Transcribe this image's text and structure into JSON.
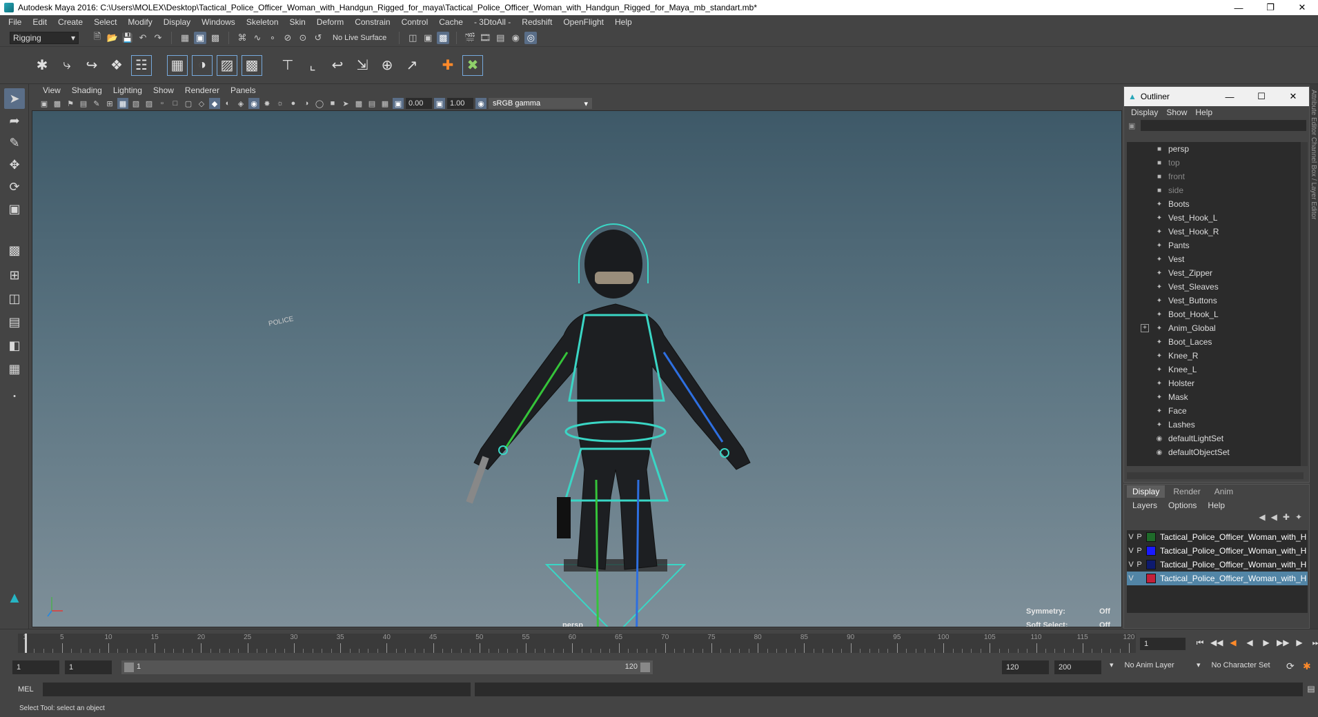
{
  "window": {
    "title": "Autodesk Maya 2016: C:\\Users\\MOLEX\\Desktop\\Tactical_Police_Officer_Woman_with_Handgun_Rigged_for_maya\\Tactical_Police_Officer_Woman_with_Handgun_Rigged_for_Maya_mb_standart.mb*"
  },
  "menubar": [
    "File",
    "Edit",
    "Create",
    "Select",
    "Modify",
    "Display",
    "Windows",
    "Skeleton",
    "Skin",
    "Deform",
    "Constrain",
    "Control",
    "Cache",
    "- 3DtoAll -",
    "Redshift",
    "OpenFlight",
    "Help"
  ],
  "statusline": {
    "mode": "Rigging",
    "live_surface": "No Live Surface"
  },
  "viewport": {
    "menu": [
      "View",
      "Shading",
      "Lighting",
      "Show",
      "Renderer",
      "Panels"
    ],
    "near_value": "0.00",
    "far_value": "1.00",
    "color_space": "sRGB gamma",
    "camera_label": "persp",
    "hud": {
      "symmetry_label": "Symmetry:",
      "symmetry_value": "Off",
      "soft_select_label": "Soft Select:",
      "soft_select_value": "Off"
    },
    "character_text": "POLICE"
  },
  "outliner": {
    "title": "Outliner",
    "menu": [
      "Display",
      "Show",
      "Help"
    ],
    "items": [
      {
        "label": "persp",
        "kind": "camera",
        "dim": false
      },
      {
        "label": "top",
        "kind": "camera",
        "dim": true
      },
      {
        "label": "front",
        "kind": "camera",
        "dim": true
      },
      {
        "label": "side",
        "kind": "camera",
        "dim": true
      },
      {
        "label": "Boots",
        "kind": "mesh",
        "dim": false
      },
      {
        "label": "Vest_Hook_L",
        "kind": "mesh",
        "dim": false
      },
      {
        "label": "Vest_Hook_R",
        "kind": "mesh",
        "dim": false
      },
      {
        "label": "Pants",
        "kind": "mesh",
        "dim": false
      },
      {
        "label": "Vest",
        "kind": "mesh",
        "dim": false
      },
      {
        "label": "Vest_Zipper",
        "kind": "mesh",
        "dim": false
      },
      {
        "label": "Vest_Sleaves",
        "kind": "mesh",
        "dim": false
      },
      {
        "label": "Vest_Buttons",
        "kind": "mesh",
        "dim": false
      },
      {
        "label": "Boot_Hook_L",
        "kind": "mesh",
        "dim": false
      },
      {
        "label": "Anim_Global",
        "kind": "mesh",
        "dim": false,
        "expandable": true
      },
      {
        "label": "Boot_Laces",
        "kind": "mesh",
        "dim": false
      },
      {
        "label": "Knee_R",
        "kind": "mesh",
        "dim": false
      },
      {
        "label": "Knee_L",
        "kind": "mesh",
        "dim": false
      },
      {
        "label": "Holster",
        "kind": "mesh",
        "dim": false
      },
      {
        "label": "Mask",
        "kind": "mesh",
        "dim": false
      },
      {
        "label": "Face",
        "kind": "mesh",
        "dim": false
      },
      {
        "label": "Lashes",
        "kind": "mesh",
        "dim": false
      },
      {
        "label": "defaultLightSet",
        "kind": "set",
        "dim": false
      },
      {
        "label": "defaultObjectSet",
        "kind": "set",
        "dim": false
      }
    ]
  },
  "layers": {
    "tabs": [
      "Display",
      "Render",
      "Anim"
    ],
    "menu": [
      "Layers",
      "Options",
      "Help"
    ],
    "rows": [
      {
        "v": "V",
        "p": "P",
        "color": "#1f6b2a",
        "name": "Tactical_Police_Officer_Woman_with_H",
        "selected": false
      },
      {
        "v": "V",
        "p": "P",
        "color": "#1a1aff",
        "name": "Tactical_Police_Officer_Woman_with_H",
        "selected": false
      },
      {
        "v": "V",
        "p": "P",
        "color": "#0d1a6e",
        "name": "Tactical_Police_Officer_Woman_with_H",
        "selected": false
      },
      {
        "v": "V",
        "p": "",
        "color": "#c2203a",
        "name": "Tactical_Police_Officer_Woman_with_H",
        "selected": true
      }
    ]
  },
  "right_strip": "Attribute Editor  Channel Box / Layer Editor",
  "timeline": {
    "labels": [
      "1",
      "5",
      "10",
      "15",
      "20",
      "25",
      "30",
      "35",
      "40",
      "45",
      "50",
      "55",
      "60",
      "65",
      "70",
      "75",
      "80",
      "85",
      "90",
      "95",
      "100",
      "105",
      "110",
      "115",
      "120"
    ],
    "current_frame": "1"
  },
  "range": {
    "start": "1",
    "playback_start": "1",
    "slider_start": "1",
    "slider_end": "120",
    "playback_end": "120",
    "end": "200",
    "anim_layer": "No Anim Layer",
    "character_set": "No Character Set"
  },
  "cmdline": {
    "label": "MEL"
  },
  "helpline": {
    "text": "Select Tool: select an object"
  }
}
